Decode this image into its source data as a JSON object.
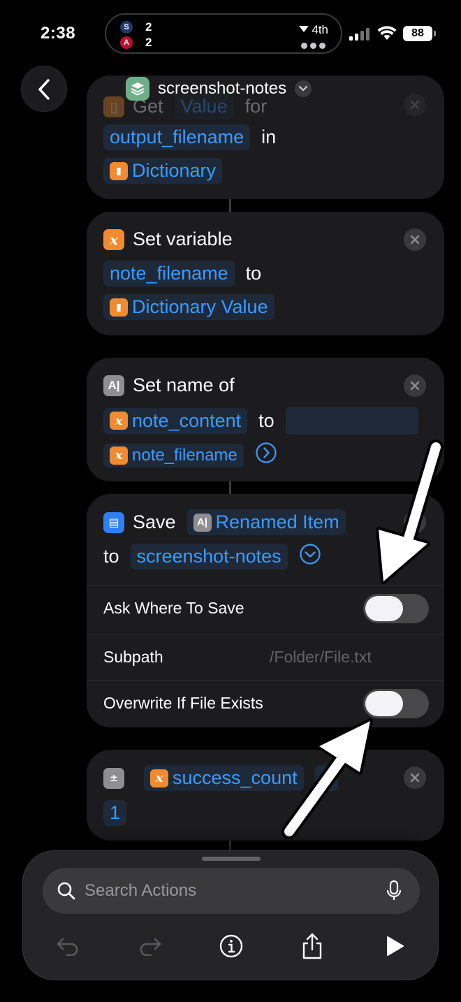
{
  "status_bar": {
    "time": "2:38",
    "live_activity": {
      "team_a_score": "2",
      "team_b_score": "2",
      "inning": "4th"
    },
    "battery": "88"
  },
  "header": {
    "title": "screenshot-notes"
  },
  "actions": {
    "get_value": {
      "word_get": "Get",
      "word_value": "Value",
      "word_for": "for",
      "key": "output_filename",
      "word_in": "in",
      "source": "Dictionary"
    },
    "set_variable": {
      "title": "Set variable",
      "variable": "note_filename",
      "word_to": "to",
      "value": "Dictionary Value"
    },
    "set_name": {
      "title": "Set name of",
      "target": "note_content",
      "word_to": "to",
      "name": "note_filename"
    },
    "save": {
      "title": "Save",
      "item": "Renamed Item",
      "word_to": "to",
      "destination": "screenshot-notes",
      "ask_where_label": "Ask Where To Save",
      "ask_where_on": false,
      "subpath_label": "Subpath",
      "subpath_placeholder": "/Folder/File.txt",
      "overwrite_label": "Overwrite If File Exists",
      "overwrite_on": false
    },
    "calculate": {
      "variable": "success_count",
      "operator": "+",
      "operand": "1"
    }
  },
  "bottom_sheet": {
    "search_placeholder": "Search Actions"
  },
  "colors": {
    "accent": "#3a9bff",
    "variable_orange": "#f28b30",
    "card_bg": "#1c1c1e"
  }
}
